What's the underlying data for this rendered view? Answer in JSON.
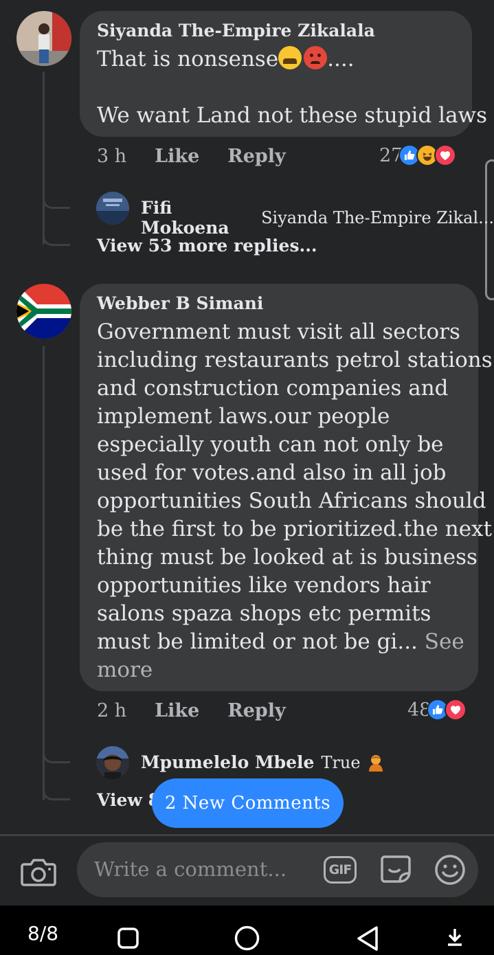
{
  "comments": [
    {
      "author": "Siyanda The-Empire Zikalala",
      "line1": "That is nonsense",
      "line1_suffix": "....",
      "line2": "We want Land not these stupid laws",
      "time": "3 h",
      "like_label": "Like",
      "reply_label": "Reply",
      "reaction_count": "27",
      "reactions": [
        "like",
        "haha",
        "love"
      ],
      "reply_preview": {
        "name": "Fifi Mokoena",
        "text": "Siyanda The-Empire Zikal..."
      },
      "view_more": "View 53 more replies..."
    },
    {
      "author": "Webber B Simani",
      "lines": [
        "Government must visit all sectors",
        "including restaurants petrol stations",
        "and construction companies and",
        "implement laws.our people",
        "especially youth can not only be",
        "used for votes.and also in all job",
        "opportunities South Africans should",
        "be the first to be prioritized.the next",
        "thing must be looked at is business",
        "opportunities like vendors hair",
        "salons spaza shops etc permits",
        "must be limited or not be gi..."
      ],
      "see_more_a": "See",
      "see_more_b": "more",
      "time": "2 h",
      "like_label": "Like",
      "reply_label": "Reply",
      "reaction_count": "48",
      "reactions": [
        "like",
        "love"
      ],
      "reply_preview": {
        "name": "Mpumelelo Mbele",
        "text": "True"
      },
      "view_more": "View 8"
    }
  ],
  "new_comments_button": "2 New Comments",
  "composer": {
    "placeholder": "Write a comment...",
    "gif_label": "GIF"
  },
  "navbar": {
    "page_count": "8/8"
  },
  "colors": {
    "background": "#242526",
    "bubble": "#3a3b3c",
    "accent": "#2d88ff",
    "love": "#f33e58",
    "haha": "#f7b125"
  }
}
